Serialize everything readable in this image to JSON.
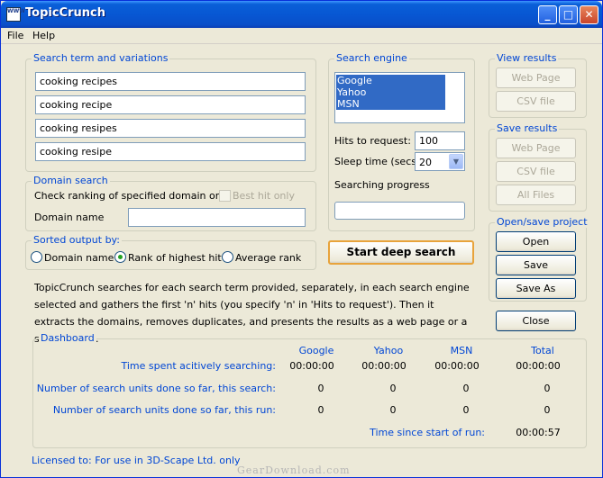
{
  "window": {
    "title": "TopicCrunch",
    "icon_text": "WWW"
  },
  "menu": [
    "File",
    "Help"
  ],
  "search_terms": {
    "legend": "Search term and variations",
    "values": [
      "cooking recipes",
      "cooking recipe",
      "cooking resipes",
      "cooking resipe"
    ]
  },
  "domain_search": {
    "legend": "Domain search",
    "check_label": "Check ranking of specified domain only",
    "best_hit_label": "Best hit only",
    "domain_name_label": "Domain name",
    "domain_name_value": ""
  },
  "sorted_output": {
    "legend": "Sorted output by:",
    "options": [
      "Domain name",
      "Rank of highest hit",
      "Average rank"
    ],
    "selected": "Rank of highest hit"
  },
  "search_engine": {
    "legend": "Search engine",
    "items": [
      "Google",
      "Yahoo",
      "MSN"
    ],
    "hits_label": "Hits to request:",
    "hits_value": "100",
    "sleep_label": "Sleep time (secs)",
    "sleep_value": "20",
    "progress_label": "Searching progress",
    "progress": 0
  },
  "start_button": "Start deep search",
  "view_results": {
    "legend": "View results",
    "buttons": [
      "Web Page",
      "CSV file"
    ]
  },
  "save_results": {
    "legend": "Save results",
    "buttons": [
      "Web Page",
      "CSV file",
      "All Files"
    ]
  },
  "project": {
    "legend": "Open/save project",
    "buttons": [
      "Open",
      "Save",
      "Save As"
    ]
  },
  "close_button": "Close",
  "description": "TopicCrunch searches for each search term provided, separately, in each search engine selected and gathers the first 'n' hits (you specify 'n' in 'Hits to request'). Then it extracts the domains, removes duplicates, and presents the results as a web page or a spreadsheet.",
  "dashboard": {
    "legend": "Dashboard",
    "columns": [
      "Google",
      "Yahoo",
      "MSN",
      "Total"
    ],
    "rows": [
      {
        "label": "Time spent acitively searching:",
        "values": [
          "00:00:00",
          "00:00:00",
          "00:00:00",
          "00:00:00"
        ]
      },
      {
        "label": "Number of search units done so far, this search:",
        "values": [
          "0",
          "0",
          "0",
          "0"
        ]
      },
      {
        "label": "Number of search units done so far, this run:",
        "values": [
          "0",
          "0",
          "0",
          "0"
        ]
      }
    ],
    "since_label": "Time since start of run:",
    "since_value": "00:00:57"
  },
  "license": "Licensed to: For use in 3D-Scape Ltd. only",
  "watermark": "GearDownload.com",
  "colors": {
    "accent": "#0046d5",
    "selection": "#316ac5",
    "titlebar": "#0a5fd8"
  }
}
